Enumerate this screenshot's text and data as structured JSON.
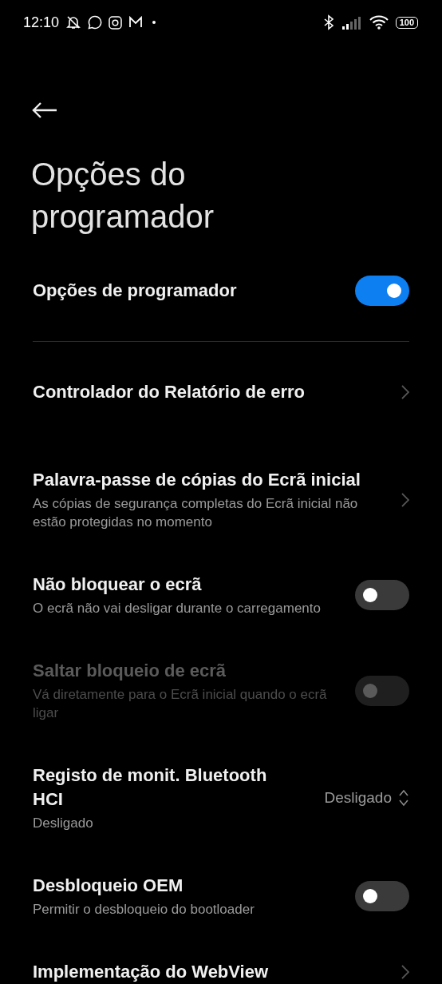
{
  "status_bar": {
    "time": "12:10",
    "battery": "100"
  },
  "title": "Opções do programador",
  "master": {
    "label": "Opções de programador",
    "on": true
  },
  "items": [
    {
      "kind": "link",
      "title": "Controlador do Relatório de erro"
    },
    {
      "kind": "link",
      "title": "Palavra-passe de cópias do Ecrã inicial",
      "subtitle": "As cópias de segurança completas do Ecrã inicial não estão protegidas no momento"
    },
    {
      "kind": "toggle",
      "title": "Não bloquear o ecrã",
      "subtitle": "O ecrã não vai desligar durante o carregamento",
      "on": false,
      "disabled": false
    },
    {
      "kind": "toggle",
      "title": "Saltar bloqueio de ecrã",
      "subtitle": "Vá diretamente para o Ecrã inicial quando o ecrã ligar",
      "on": false,
      "disabled": true
    },
    {
      "kind": "dropdown",
      "title": "Registo de monit. Bluetooth HCI",
      "subtitle": "Desligado",
      "value": "Desligado"
    },
    {
      "kind": "toggle",
      "title": "Desbloqueio OEM",
      "subtitle": "Permitir o desbloqueio do bootloader",
      "on": false,
      "disabled": false
    },
    {
      "kind": "link",
      "title": "Implementação do WebView"
    }
  ]
}
